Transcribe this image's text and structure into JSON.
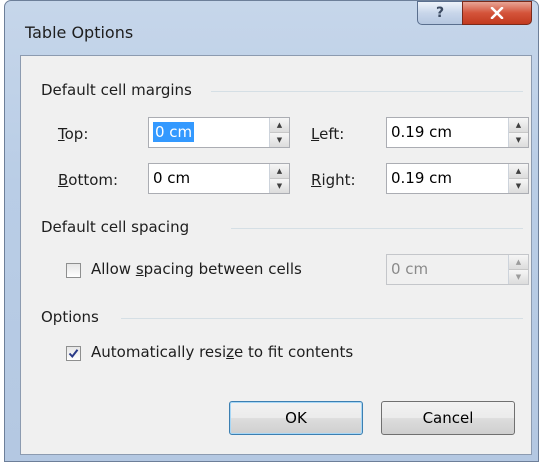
{
  "window": {
    "title": "Table Options",
    "help_glyph": "?"
  },
  "margins": {
    "group_label": "Default cell margins",
    "top_label_u": "T",
    "top_label_rest": "op:",
    "top_value": "0 cm",
    "bottom_label_u": "B",
    "bottom_label_rest": "ottom:",
    "bottom_value": "0 cm",
    "left_label_u": "L",
    "left_label_rest": "eft:",
    "left_value": "0.19 cm",
    "right_label_u": "R",
    "right_label_rest": "ight:",
    "right_value": "0.19 cm"
  },
  "spacing": {
    "group_label": "Default cell spacing",
    "allow_label_pre": "Allow ",
    "allow_label_u": "s",
    "allow_label_post": "pacing between cells",
    "allow_checked": false,
    "spacing_value": "0 cm"
  },
  "options": {
    "group_label": "Options",
    "autoresize_label_pre": "Automatically resi",
    "autoresize_label_u": "z",
    "autoresize_label_post": "e to fit contents",
    "autoresize_checked": true
  },
  "buttons": {
    "ok_label": "OK",
    "cancel_label": "Cancel"
  },
  "colors": {
    "accent": "#3399ff",
    "close_red": "#c23a1f",
    "frame_blue": "#b9cde6"
  }
}
